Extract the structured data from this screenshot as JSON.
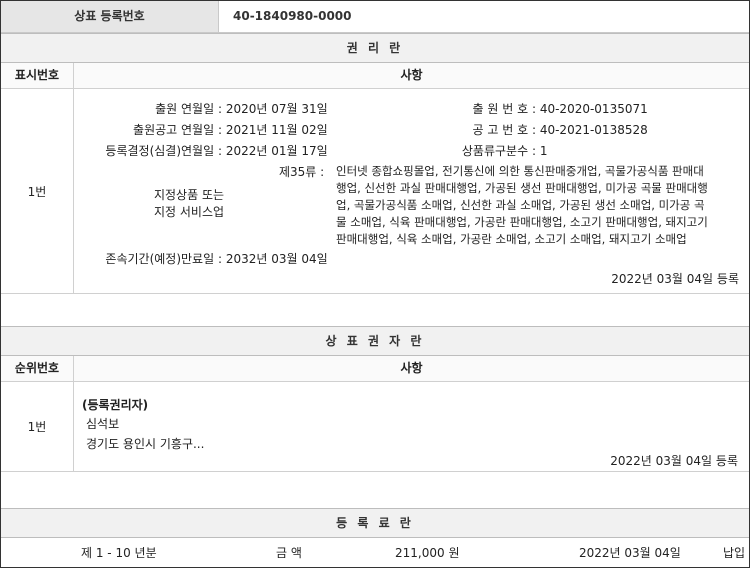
{
  "reg": {
    "label": "상표 등록번호",
    "value": "40-1840980-0000"
  },
  "rights_section": {
    "title": "권 리 란",
    "col_num": "표시번호",
    "col_content": "사항",
    "row_num": "1번",
    "filing_date_label": "출원 연월일 :",
    "filing_date": "2020년 07월 31일",
    "pub_date_label": "출원공고 연월일 :",
    "pub_date": "2021년 11월 02일",
    "decision_date_label": "등록결정(심결)연월일 :",
    "decision_date": "2022년 01월 17일",
    "app_no_label": "출 원 번 호 :",
    "app_no": "40-2020-0135071",
    "pub_no_label": "공 고 번 호 :",
    "pub_no": "40-2021-0138528",
    "class_count_label": "상품류구분수 :",
    "class_count": "1",
    "goods_label_1": "지정상품 또는",
    "goods_label_2": "지정 서비스업",
    "class_label": "제35류 :",
    "goods_lines": [
      "인터넷 종합쇼핑몰업, 전기통신에 의한 통신판매중개업, 곡물가공식품 판매대",
      "행업, 신선한 과실 판매대행업, 가공된 생선 판매대행업, 미가공 곡물 판매대행",
      "업, 곡물가공식품 소매업, 신선한 과실 소매업, 가공된 생선 소매업, 미가공 곡",
      "물 소매업, 식육 판매대행업, 가공란 판매대행업, 소고기 판매대행업, 돼지고기",
      "판매대행업, 식육 소매업, 가공란 소매업, 소고기 소매업, 돼지고기 소매업"
    ],
    "expiry_label": "존속기간(예정)만료일 :",
    "expiry": "2032년 03월 04일",
    "reg_note": "2022년 03월 04일 등록"
  },
  "holder_section": {
    "title": "상 표 권 자 란",
    "col_num": "순위번호",
    "col_content": "사항",
    "row_num": "1번",
    "type": "(등록권리자)",
    "name": "심석보",
    "address": "경기도 용인시 기흥구...",
    "reg_note": "2022년 03월 04일 등록"
  },
  "fee_section": {
    "title": "등 록 료 란",
    "period": "제 1 - 10 년분",
    "amount_label": "금 액",
    "amount": "211,000 원",
    "date": "2022년 03월 04일",
    "status": "납입"
  }
}
